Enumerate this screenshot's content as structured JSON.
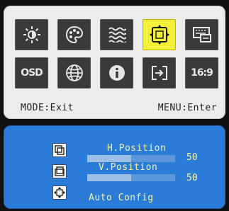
{
  "menu": {
    "tiles": [
      {
        "icon": "brightness-icon",
        "text": ""
      },
      {
        "icon": "color-palette-icon",
        "text": ""
      },
      {
        "icon": "image-waves-icon",
        "text": ""
      },
      {
        "icon": "position-icon",
        "text": "",
        "selected": true
      },
      {
        "icon": "monitor-setup-icon",
        "text": ""
      },
      {
        "icon": "osd-setup-icon",
        "text": "OSD"
      },
      {
        "icon": "language-globe-icon",
        "text": ""
      },
      {
        "icon": "information-icon",
        "text": ""
      },
      {
        "icon": "input-source-icon",
        "text": ""
      },
      {
        "icon": "aspect-ratio-icon",
        "text": "16:9"
      }
    ],
    "hint_left": "MODE:Exit",
    "hint_right": "MENU:Enter"
  },
  "submenu": {
    "h_position": {
      "label": "H.Position",
      "value": "50",
      "level": 0.5
    },
    "v_position": {
      "label": "V.Position",
      "value": "50",
      "level": 0.5
    },
    "auto_config": {
      "label": "Auto Config"
    }
  },
  "colors": {
    "selected_tile": "#f3f03a",
    "tile": "#3a3a3a",
    "submenu_bg": "#2b7bd8",
    "submenu_text": "#f4f4a6"
  }
}
